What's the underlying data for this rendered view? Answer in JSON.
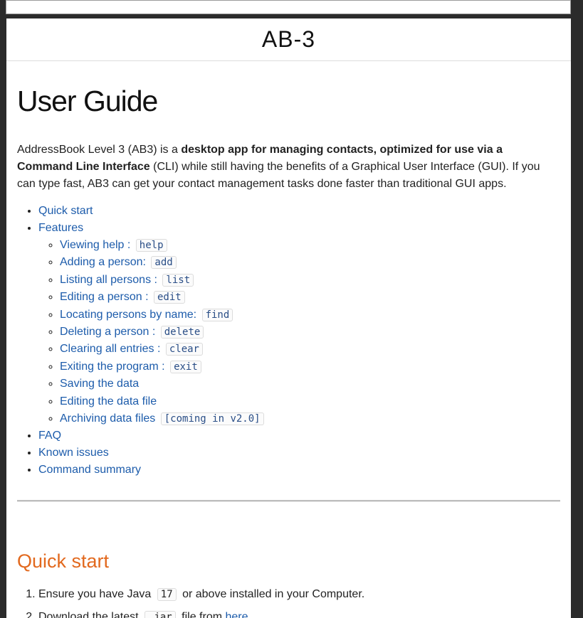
{
  "header": {
    "site_title": "AB-3"
  },
  "page": {
    "title": "User Guide",
    "intro": {
      "part1": "AddressBook Level 3 (AB3) is a ",
      "bold1": "desktop app for managing contacts, optimized for use via a Command Line Interface",
      "part2": " (CLI) while still having the benefits of a Graphical User Interface (GUI). If you can type fast, AB3 can get your contact management tasks done faster than traditional GUI apps."
    },
    "toc": {
      "quick_start": "Quick start",
      "features": "Features",
      "feature_items": [
        {
          "label": "Viewing help : ",
          "code": "help"
        },
        {
          "label": "Adding a person: ",
          "code": "add"
        },
        {
          "label": "Listing all persons : ",
          "code": "list"
        },
        {
          "label": "Editing a person : ",
          "code": "edit"
        },
        {
          "label": "Locating persons by name: ",
          "code": "find"
        },
        {
          "label": "Deleting a person : ",
          "code": "delete"
        },
        {
          "label": "Clearing all entries : ",
          "code": "clear"
        },
        {
          "label": "Exiting the program : ",
          "code": "exit"
        },
        {
          "label": "Saving the data",
          "code": ""
        },
        {
          "label": "Editing the data file",
          "code": ""
        },
        {
          "label": "Archiving data files ",
          "code": "[coming in v2.0]"
        }
      ],
      "faq": "FAQ",
      "known_issues": "Known issues",
      "command_summary": "Command summary"
    },
    "quick_start": {
      "heading": "Quick start",
      "step1": {
        "before": "Ensure you have Java ",
        "code": "17",
        "after": " or above installed in your Computer."
      },
      "step2": {
        "before": "Download the latest ",
        "code": ".jar",
        "after": " file from ",
        "link": "here"
      }
    }
  }
}
